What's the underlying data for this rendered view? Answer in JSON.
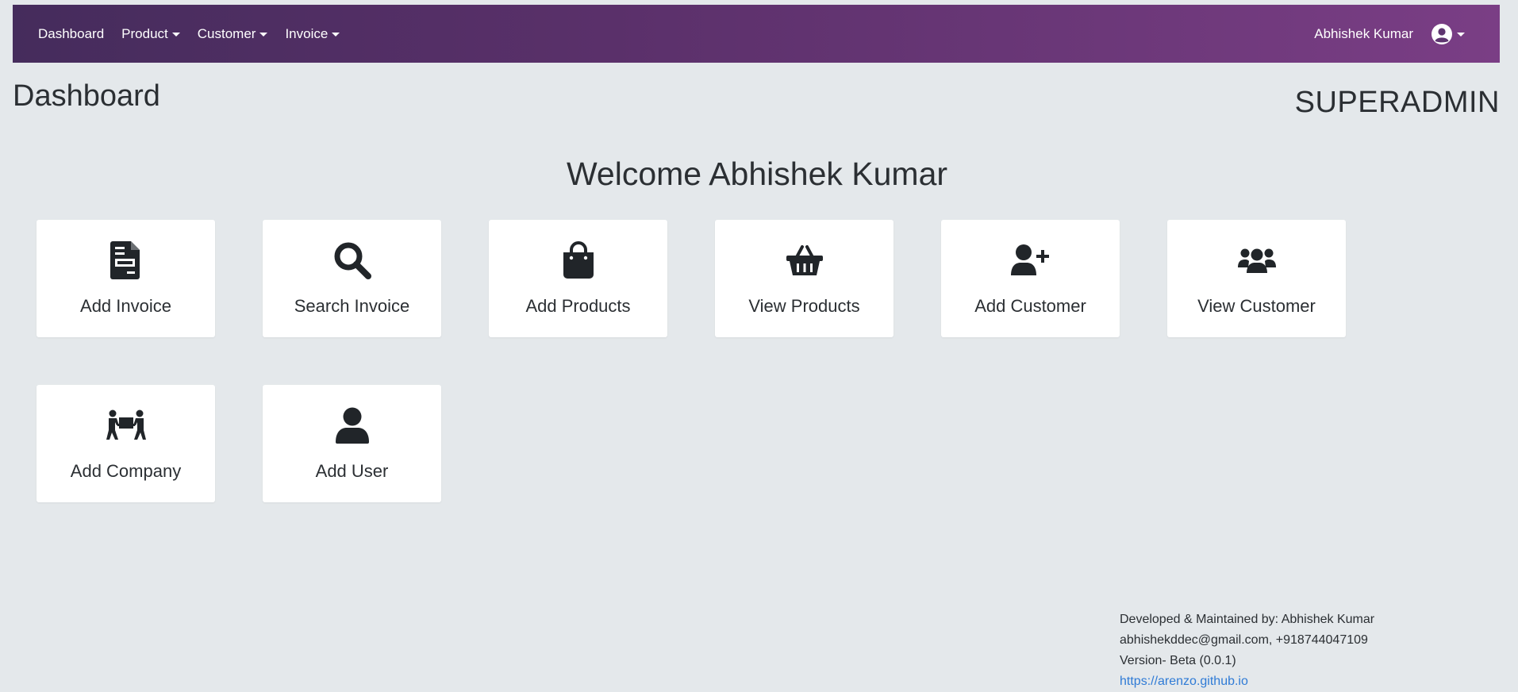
{
  "nav": {
    "links": [
      {
        "label": "Dashboard",
        "dropdown": false
      },
      {
        "label": "Product",
        "dropdown": true
      },
      {
        "label": "Customer",
        "dropdown": true
      },
      {
        "label": "Invoice",
        "dropdown": true
      }
    ],
    "user_name": "Abhishek Kumar",
    "profile_icon": "user-circle-icon"
  },
  "page": {
    "title": "Dashboard",
    "role": "SUPERADMIN",
    "welcome": "Welcome Abhishek Kumar"
  },
  "cards": [
    {
      "label": "Add Invoice",
      "icon": "invoice-file-icon"
    },
    {
      "label": "Search Invoice",
      "icon": "search-icon"
    },
    {
      "label": "Add Products",
      "icon": "shopping-bag-icon"
    },
    {
      "label": "View Products",
      "icon": "basket-icon"
    },
    {
      "label": "Add Customer",
      "icon": "user-plus-icon"
    },
    {
      "label": "View Customer",
      "icon": "users-icon"
    },
    {
      "label": "Add Company",
      "icon": "people-carry-icon"
    },
    {
      "label": "Add User",
      "icon": "user-icon"
    }
  ],
  "footer": {
    "developer": "Developed & Maintained by: Abhishek Kumar",
    "contact": "abhishekddec@gmail.com, +918744047109",
    "version": "Version- Beta (0.0.1)",
    "link": "https://arenzo.github.io"
  },
  "colors": {
    "navbar_start": "#452c5c",
    "navbar_end": "#7a3e85",
    "background": "#e4e8eb",
    "link": "#2f7bd6"
  }
}
